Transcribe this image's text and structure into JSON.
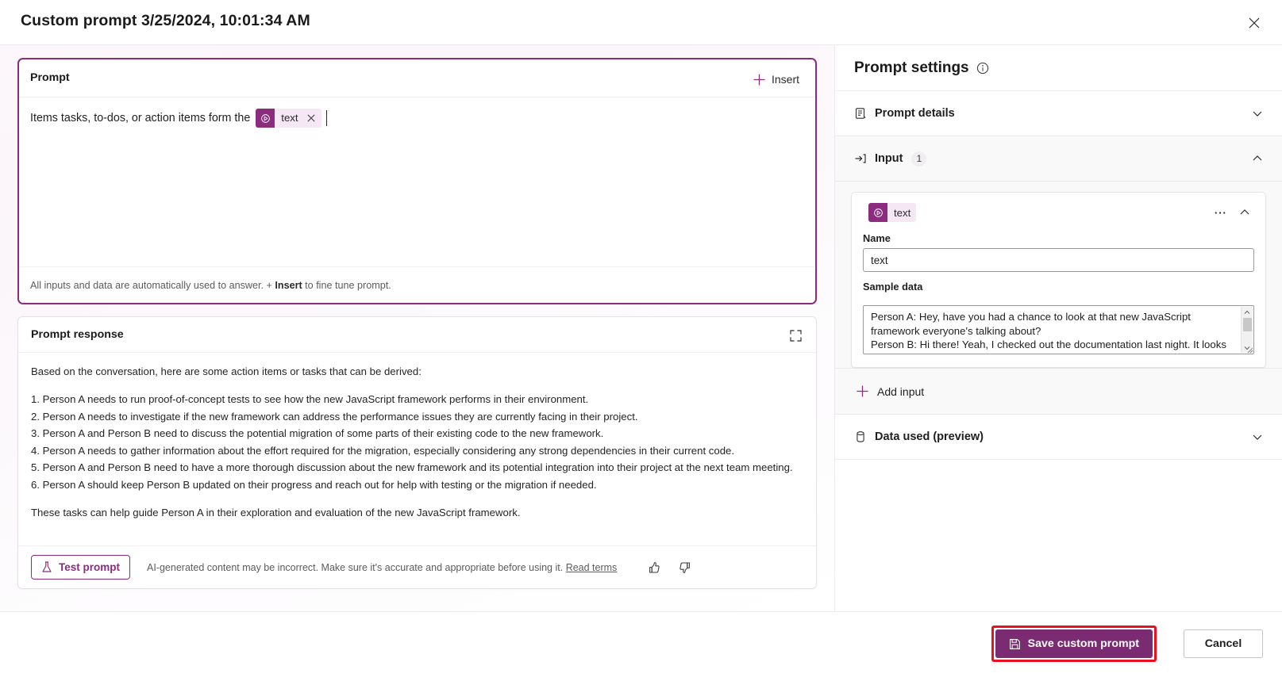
{
  "window": {
    "title": "Custom prompt 3/25/2024, 10:01:34 AM",
    "close_label": "Close"
  },
  "prompt_card": {
    "label": "Prompt",
    "insert_label": "Insert",
    "text_before_token": "Items tasks, to-dos, or action items form the",
    "token_label": "text",
    "footer_prefix": "All inputs and data are automatically used to answer. + ",
    "footer_bold": "Insert",
    "footer_suffix": " to fine tune prompt."
  },
  "response_card": {
    "label": "Prompt response",
    "intro": "Based on the conversation, here are some action items or tasks that can be derived:",
    "items": [
      "1. Person A needs to run proof-of-concept tests to see how the new JavaScript framework performs in their environment.",
      "2. Person A needs to investigate if the new framework can address the performance issues they are currently facing in their project.",
      "3. Person A and Person B need to discuss the potential migration of some parts of their existing code to the new framework.",
      "4. Person A needs to gather information about the effort required for the migration, especially considering any strong dependencies in their current code.",
      "5. Person A and Person B need to have a more thorough discussion about the new framework and its potential integration into their project at the next team meeting.",
      "6. Person A should keep Person B updated on their progress and reach out for help with testing or the migration if needed."
    ],
    "outro": "These tasks can help guide Person A in their exploration and evaluation of the new JavaScript framework.",
    "test_prompt_label": "Test prompt",
    "disclaimer": "AI-generated content may be incorrect. Make sure it's accurate and appropriate before using it.",
    "read_terms_label": "Read terms"
  },
  "settings": {
    "title": "Prompt settings",
    "prompt_details_label": "Prompt details",
    "input_label": "Input",
    "input_count": "1",
    "input_item": {
      "token_label": "text",
      "name_label": "Name",
      "name_value": "text",
      "sample_label": "Sample data",
      "sample_value": "Person A: Hey, have you had a chance to look at that new JavaScript framework everyone's talking about?\nPerson B: Hi there! Yeah, I checked out the documentation last night. It looks promising. Performance seems solid, but there's a"
    },
    "add_input_label": "Add input",
    "data_used_label": "Data used (preview)"
  },
  "footer": {
    "save_label": "Save custom prompt",
    "cancel_label": "Cancel"
  },
  "colors": {
    "accent": "#8b2c7e",
    "save_button": "#7b2b72",
    "highlight": "#e81123",
    "token_chip_bg": "#f6e7f4"
  }
}
